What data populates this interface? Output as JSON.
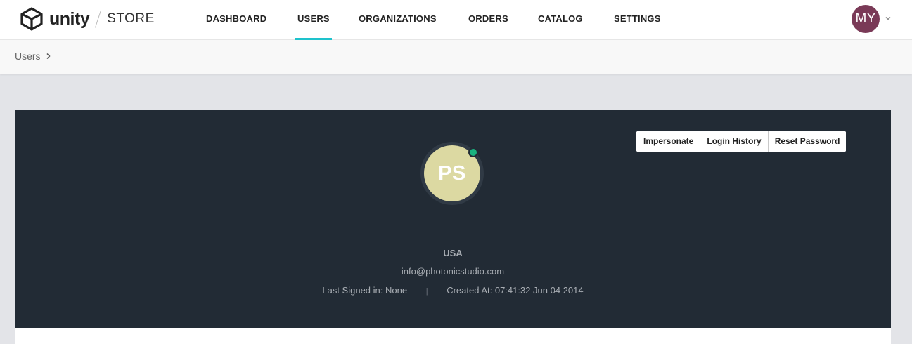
{
  "header": {
    "logo_word": "unity",
    "logo_store": "STORE",
    "nav": [
      {
        "label": "DASHBOARD",
        "active": false
      },
      {
        "label": "USERS",
        "active": true
      },
      {
        "label": "ORGANIZATIONS",
        "active": false
      },
      {
        "label": "ORDERS",
        "active": false
      },
      {
        "label": "CATALOG",
        "active": false
      },
      {
        "label": "SETTINGS",
        "active": false
      }
    ],
    "account_initials": "MY"
  },
  "breadcrumb": {
    "items": [
      "Users"
    ]
  },
  "profile": {
    "actions": [
      "Impersonate",
      "Login History",
      "Reset Password"
    ],
    "avatar_initials": "PS",
    "online": true,
    "country": "USA",
    "email": "info@photonicstudio.com",
    "last_signed_in": "Last Signed in: None",
    "separator": "|",
    "created_at": "Created At: 07:41:32 Jun 04 2014"
  },
  "colors": {
    "accent": "#1ec2cc",
    "card_bg": "#222b35",
    "account_avatar_bg": "#7a3a57",
    "user_avatar_bg": "#dcd9a2",
    "online": "#1ab37f"
  }
}
